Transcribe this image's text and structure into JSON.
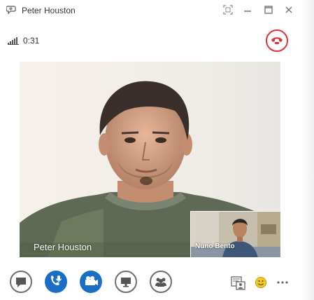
{
  "window": {
    "title": "Peter Houston",
    "app_icon": "lync-chat-icon",
    "controls": [
      "fullscreen-icon",
      "minimize-icon",
      "maximize-icon",
      "close-icon"
    ]
  },
  "call": {
    "duration": "0:31",
    "signal_icon": "signal-strength-icon",
    "hangup_icon": "hang-up-icon",
    "hangup_color": "#e0303a"
  },
  "video": {
    "main_participant": "Peter Houston",
    "self_view_participant": "Nuno Bento"
  },
  "toolbar": {
    "buttons": [
      {
        "icon": "chat-icon",
        "active": false
      },
      {
        "icon": "phone-mic-icon",
        "active": true
      },
      {
        "icon": "video-camera-icon",
        "active": true
      },
      {
        "icon": "presentation-monitor-icon",
        "active": false
      },
      {
        "icon": "participants-icon",
        "active": false
      }
    ],
    "accent_color": "#1a6fc4",
    "right_icons": [
      "contact-card-icon",
      "emoticon-icon",
      "more-options-icon"
    ]
  }
}
